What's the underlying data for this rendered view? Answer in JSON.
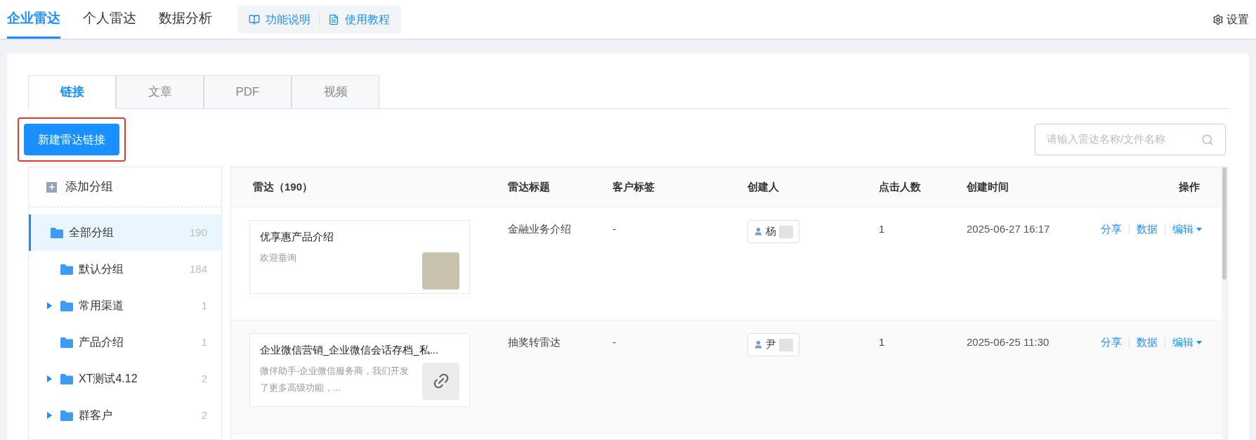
{
  "top_nav": {
    "tabs": [
      {
        "label": "企业雷达",
        "selected": true
      },
      {
        "label": "个人雷达",
        "selected": false
      },
      {
        "label": "数据分析",
        "selected": false
      }
    ],
    "help_links": [
      {
        "kind": "book",
        "label": "功能说明"
      },
      {
        "kind": "doc",
        "label": "使用教程"
      }
    ],
    "settings": "设置"
  },
  "content_tabs": [
    {
      "label": "链接",
      "selected": true
    },
    {
      "label": "文章",
      "selected": false
    },
    {
      "label": "PDF",
      "selected": false
    },
    {
      "label": "视频",
      "selected": false
    }
  ],
  "new_button": {
    "label": "新建雷达链接",
    "highlighted": true
  },
  "search": {
    "placeholder": "请输入雷达名称/文件名称"
  },
  "sidebar": {
    "add_group": "添加分组",
    "groups": [
      {
        "name": "全部分组",
        "count": "190",
        "selected": true,
        "collapsible": false,
        "children": [
          {
            "name": "默认分组",
            "count": "184",
            "selected": false,
            "collapsible": false
          },
          {
            "name": "常用渠道",
            "count": "1",
            "selected": false,
            "collapsible": true
          },
          {
            "name": "产品介绍",
            "count": "1",
            "selected": false,
            "collapsible": false
          },
          {
            "name": "XT测试4.12",
            "count": "2",
            "selected": false,
            "collapsible": true
          },
          {
            "name": "群客户",
            "count": "2",
            "selected": false,
            "collapsible": true
          }
        ]
      }
    ]
  },
  "table": {
    "columns": [
      "雷达（190）",
      "雷达标题",
      "客户标签",
      "创建人",
      "点击人数",
      "创建时间",
      "操作"
    ],
    "rows": [
      {
        "card_title": "优享惠产品介绍",
        "card_desc": "欢迎垂询",
        "kind": "photo",
        "title": "金融业务介绍",
        "tags": "-",
        "creator": "杨",
        "clicks": "1",
        "created": "2025-06-27 16:17",
        "actions": [
          "分享",
          "数据",
          "编辑"
        ]
      },
      {
        "card_title": "企业微信营销_企业微信会话存档_私...",
        "card_desc": "微伴助手-企业微信服务商，我们开发了更多高级功能，...",
        "kind": "link",
        "title": "抽奖转雷达",
        "tags": "-",
        "creator": "尹",
        "clicks": "1",
        "created": "2025-06-25 11:30",
        "actions": [
          "分享",
          "数据",
          "编辑"
        ]
      }
    ]
  }
}
